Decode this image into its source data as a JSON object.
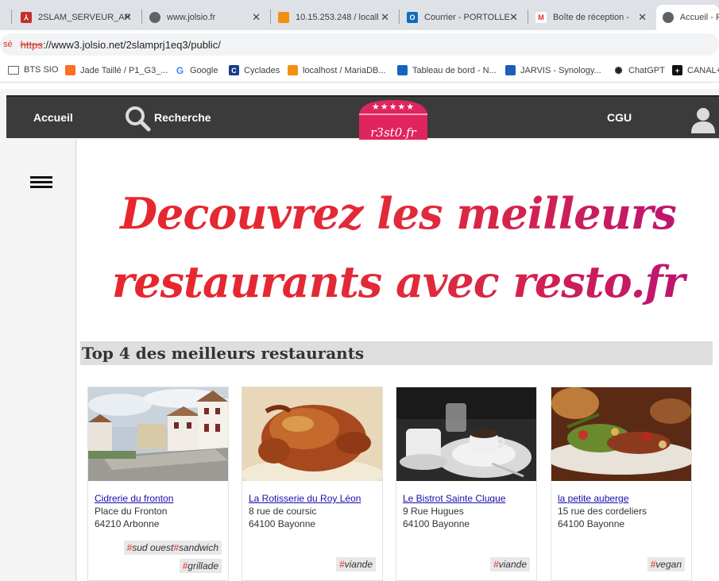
{
  "browser": {
    "tabs": [
      {
        "title": "2SLAM_SERVEUR_AP",
        "icon": "pdf-icon"
      },
      {
        "title": "www.jolsio.fr",
        "icon": "globe-icon"
      },
      {
        "title": "10.15.253.248 / locall",
        "icon": "phpmyadmin-icon"
      },
      {
        "title": "Courrier - PORTOLLE",
        "icon": "outlook-icon"
      },
      {
        "title": "Boîte de réception -",
        "icon": "gmail-icon"
      },
      {
        "title": "Accueil - R",
        "icon": "globe-icon"
      }
    ],
    "address": {
      "security_label": "sé",
      "scheme": "https",
      "rest": "://www3.jolsio.net/2slamprj1eq3/public/"
    },
    "bookmarks": [
      {
        "label": "BTS SIO",
        "icon": "folder-icon"
      },
      {
        "label": "Jade Taillé / P1_G3_...",
        "icon": "gitlab-icon"
      },
      {
        "label": "Google",
        "icon": "google-icon"
      },
      {
        "label": "Cyclades",
        "icon": "cyclades-icon"
      },
      {
        "label": "localhost / MariaDB...",
        "icon": "phpmyadmin-icon"
      },
      {
        "label": "Tableau de bord - N...",
        "icon": "dashboard-icon"
      },
      {
        "label": "JARVIS - Synology...",
        "icon": "synology-icon"
      },
      {
        "label": "ChatGPT",
        "icon": "chatgpt-icon"
      },
      {
        "label": "CANAL+",
        "icon": "canal-icon"
      }
    ]
  },
  "nav": {
    "home": "Accueil",
    "search": "Recherche",
    "terms": "CGU",
    "logo_text": "r3st0.fr",
    "logo_stars": "★★★★★"
  },
  "hero": {
    "line1": "Decouvrez les meilleurs",
    "line2": "restaurants avec resto.fr"
  },
  "section": {
    "title": "Top 4 des meilleurs restaurants"
  },
  "restaurants": [
    {
      "name": "Cidrerie du fronton",
      "street": "Place du Fronton",
      "city": "64210 Arbonne",
      "tags": [
        [
          "sud ouest",
          "sandwich"
        ],
        [
          "grillade"
        ]
      ]
    },
    {
      "name": "La Rotisserie du Roy Léon",
      "street": "8 rue de coursic",
      "city": "64100 Bayonne",
      "tags": [
        [
          "viande"
        ]
      ]
    },
    {
      "name": "Le Bistrot Sainte Cluque",
      "street": "9 Rue Hugues",
      "city": "64100 Bayonne",
      "tags": [
        [
          "viande"
        ]
      ]
    },
    {
      "name": "la petite auberge",
      "street": "15 rue des cordeliers",
      "city": "64100 Bayonne",
      "tags": [
        [
          "vegan"
        ]
      ]
    }
  ],
  "colors": {
    "navbar": "#3b3b3b",
    "hero_red": "#e8262b",
    "hero_magenta": "#b7127a",
    "logo_pink": "#e0245e",
    "link": "#1a0dab"
  }
}
